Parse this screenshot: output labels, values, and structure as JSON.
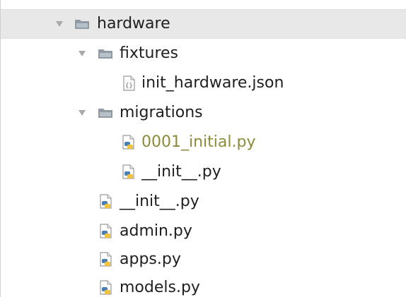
{
  "tree": {
    "items": [
      {
        "label": "hardware",
        "icon": "folder-icon",
        "expanded": true,
        "selected": true
      },
      {
        "label": "fixtures",
        "icon": "folder-icon",
        "expanded": true
      },
      {
        "label": "init_hardware.json",
        "icon": "json-file-icon"
      },
      {
        "label": "migrations",
        "icon": "folder-icon",
        "expanded": true
      },
      {
        "label": "0001_initial.py",
        "icon": "python-file-icon",
        "status": "modified"
      },
      {
        "label": "__init__.py",
        "icon": "python-file-icon"
      },
      {
        "label": "__init__.py",
        "icon": "python-file-icon"
      },
      {
        "label": "admin.py",
        "icon": "python-file-icon"
      },
      {
        "label": "apps.py",
        "icon": "python-file-icon"
      },
      {
        "label": "models.py",
        "icon": "python-file-icon"
      }
    ]
  },
  "colors": {
    "selection": "#e8e8e8",
    "text": "#1f1f1f",
    "modified_text": "#8b8b3a",
    "folder": "#8f9aa5",
    "python_blue": "#4a7fb5",
    "python_yellow": "#f2c33d"
  }
}
